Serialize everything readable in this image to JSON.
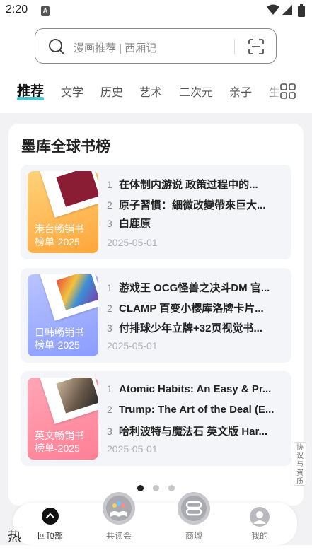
{
  "status_bar": {
    "time": "2:20",
    "notification_icon": "A"
  },
  "search": {
    "placeholder": "漫画推荐 | 西厢记"
  },
  "tabs": [
    {
      "label": "推荐",
      "active": true
    },
    {
      "label": "文学"
    },
    {
      "label": "历史"
    },
    {
      "label": "艺术"
    },
    {
      "label": "二次元"
    },
    {
      "label": "亲子"
    },
    {
      "label": "生"
    }
  ],
  "ranking": {
    "title": "墨库全球书榜",
    "lists": [
      {
        "cover_title_line1": "港台畅销书",
        "cover_title_line2": "榜单-2025",
        "items": [
          {
            "num": "1",
            "title": "在体制内游说 政策过程中的..."
          },
          {
            "num": "2",
            "title": "原子習慣：細微改變帶來巨大..."
          },
          {
            "num": "3",
            "title": "白鹿原"
          }
        ],
        "date": "2025-05-01"
      },
      {
        "cover_title_line1": "日韩畅销书",
        "cover_title_line2": "榜单-2025",
        "items": [
          {
            "num": "1",
            "title": "游戏王 OCG怪兽之决斗DM 官..."
          },
          {
            "num": "2",
            "title": "CLAMP 百变小樱库洛牌卡片..."
          },
          {
            "num": "3",
            "title": "付排球少年立牌+32页视觉书..."
          }
        ],
        "date": "2025-05-01"
      },
      {
        "cover_title_line1": "英文畅销书",
        "cover_title_line2": "榜单-2025",
        "items": [
          {
            "num": "1",
            "title": "Atomic Habits: An Easy & Pr..."
          },
          {
            "num": "2",
            "title": "Trump: The Art of the Deal (E..."
          },
          {
            "num": "3",
            "title": "哈利波特与魔法石 英文版 Har..."
          }
        ],
        "date": "2025-05-01"
      }
    ]
  },
  "side_tab": {
    "line1": "协议",
    "line2": "与资质"
  },
  "nav": [
    {
      "label": "回顶部",
      "active": true
    },
    {
      "label": "共读会"
    },
    {
      "label": "商城"
    },
    {
      "label": "我的"
    }
  ],
  "corner_text": "热",
  "colors": {
    "accent": "#4fc3c9",
    "cover_orange": "#ffb34a",
    "cover_blue": "#9aa9ff",
    "cover_pink": "#ff8fa3"
  }
}
